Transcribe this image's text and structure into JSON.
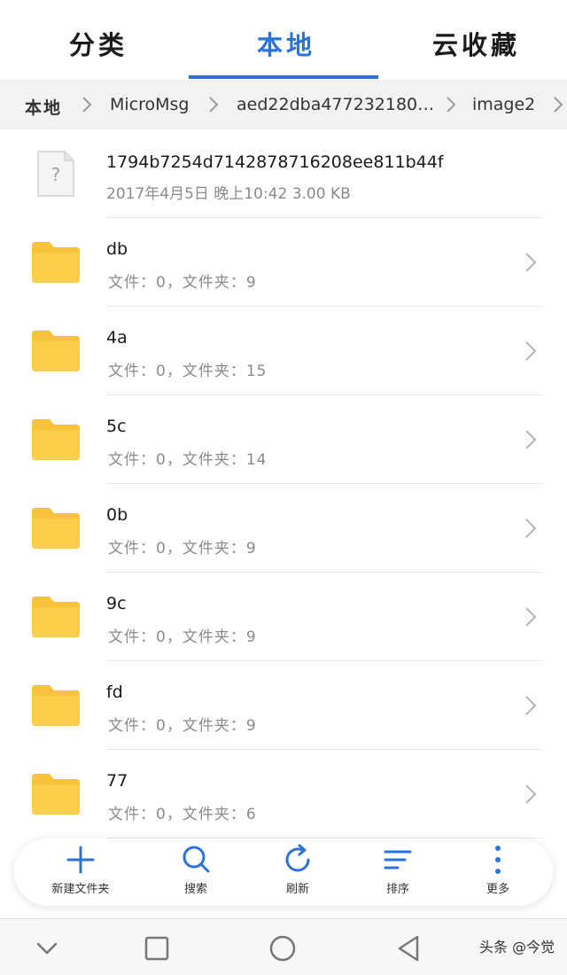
{
  "tabs": {
    "classify": "分类",
    "local": "本地",
    "cloud": "云收藏"
  },
  "breadcrumb": {
    "items": [
      "本地",
      "MicroMsg",
      "aed22dba477232180…",
      "image2"
    ]
  },
  "file": {
    "name": "1794b7254d7142878716208ee811b44f",
    "meta": "2017年4月5日 晚上10:42 3.00 KB",
    "icon": "unknown-file-icon"
  },
  "folders": [
    {
      "name": "db",
      "meta": "文件：0，文件夹：9"
    },
    {
      "name": "4a",
      "meta": "文件：0，文件夹：15"
    },
    {
      "name": "5c",
      "meta": "文件：0，文件夹：14"
    },
    {
      "name": "0b",
      "meta": "文件：0，文件夹：9"
    },
    {
      "name": "9c",
      "meta": "文件：0，文件夹：9"
    },
    {
      "name": "fd",
      "meta": "文件：0，文件夹：9"
    },
    {
      "name": "77",
      "meta": "文件：0，文件夹：6"
    }
  ],
  "toolbar": {
    "new_folder": "新建文件夹",
    "search": "搜索",
    "refresh": "刷新",
    "sort": "排序",
    "more": "更多"
  },
  "watermark": "头条 @今觉",
  "colors": {
    "accent": "#2b73d6",
    "folder": "#f8c23a",
    "secondary_text": "#8a8a8a"
  }
}
